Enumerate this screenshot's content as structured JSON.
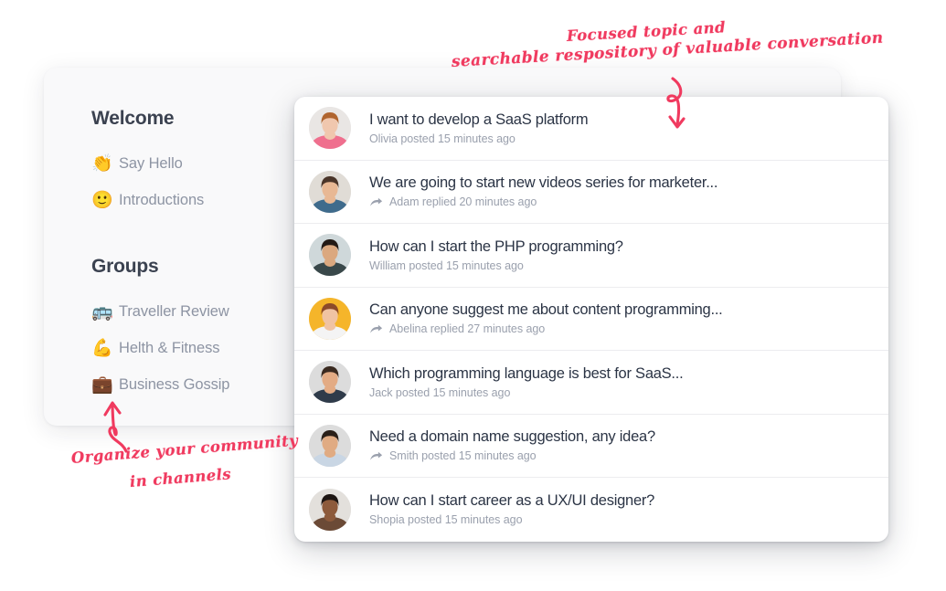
{
  "theme": {
    "accent": "#f03a5f",
    "title_color": "#2b3445",
    "meta_color": "#9aa0ad",
    "sidebar_label_color": "#8d94a3",
    "back_card_bg": "#f9f9fa",
    "front_card_bg": "#ffffff",
    "page_bg": "#ffffff",
    "divider": "#ececef"
  },
  "sidebar": {
    "welcome_title": "Welcome",
    "welcome_items": [
      {
        "emoji": "👏",
        "icon_name": "clapping-hands-emoji",
        "label": "Say Hello"
      },
      {
        "emoji": "🙂",
        "icon_name": "slightly-smiling-face-emoji",
        "label": "Introductions"
      }
    ],
    "groups_title": "Groups",
    "group_items": [
      {
        "emoji": "🚌",
        "icon_name": "bus-emoji",
        "label": "Traveller Review"
      },
      {
        "emoji": "💪",
        "icon_name": "flexed-biceps-emoji",
        "label": "Helth & Fitness"
      },
      {
        "emoji": "💼",
        "icon_name": "briefcase-emoji",
        "label": "Business Gossip"
      }
    ]
  },
  "feed": {
    "posts": [
      {
        "title": "I want to develop a SaaS platform",
        "meta": "Olivia posted 15 minutes ago",
        "author": "Olivia",
        "action": "posted",
        "time": "15 minutes ago",
        "has_reply_icon": false,
        "avatar_name": "avatar-olivia",
        "avatar_skin": "#f0c7ae",
        "avatar_hair": "#b0652f",
        "avatar_shirt": "#ef6f8e",
        "avatar_bg": "#e9e6e4"
      },
      {
        "title": "We are going to start new videos series for marketer...",
        "meta": "Adam replied 20 minutes ago",
        "author": "Adam",
        "action": "replied",
        "time": "20 minutes ago",
        "has_reply_icon": true,
        "avatar_name": "avatar-adam",
        "avatar_skin": "#e8b894",
        "avatar_hair": "#4a3529",
        "avatar_shirt": "#3f6b8c",
        "avatar_bg": "#e0dcd6"
      },
      {
        "title": "How can I start the PHP programming?",
        "meta": "William posted 15 minutes ago",
        "author": "William",
        "action": "posted",
        "time": "15 minutes ago",
        "has_reply_icon": false,
        "avatar_name": "avatar-william",
        "avatar_skin": "#dba87f",
        "avatar_hair": "#231a15",
        "avatar_shirt": "#39484a",
        "avatar_bg": "#cfd8da"
      },
      {
        "title": "Can anyone suggest me about content programming...",
        "meta": "Abelina replied 27 minutes ago",
        "author": "Abelina",
        "action": "replied",
        "time": "27 minutes ago",
        "has_reply_icon": true,
        "avatar_name": "avatar-abelina",
        "avatar_skin": "#f0c3a3",
        "avatar_hair": "#8c4a2a",
        "avatar_shirt": "#f4f4f4",
        "avatar_bg": "#f5b52a"
      },
      {
        "title": "Which programming language is best for SaaS...",
        "meta": "Jack posted 15 minutes ago",
        "author": "Jack",
        "action": "posted",
        "time": "15 minutes ago",
        "has_reply_icon": false,
        "avatar_name": "avatar-jack",
        "avatar_skin": "#e3ab84",
        "avatar_hair": "#3a2a20",
        "avatar_shirt": "#2f3b4a",
        "avatar_bg": "#dcdcdc"
      },
      {
        "title": "Need a domain name suggestion, any idea?",
        "meta": "Smith posted 15 minutes ago",
        "author": "Smith",
        "action": "posted",
        "time": "15 minutes ago",
        "has_reply_icon": true,
        "avatar_name": "avatar-smith",
        "avatar_skin": "#e0ab83",
        "avatar_hair": "#2a2019",
        "avatar_shirt": "#c9d6e4",
        "avatar_bg": "#dcdcdc"
      },
      {
        "title": "How can I start career as a UX/UI designer?",
        "meta": "Shopia posted 15 minutes ago",
        "author": "Shopia",
        "action": "posted",
        "time": "15 minutes ago",
        "has_reply_icon": false,
        "avatar_name": "avatar-shopia",
        "avatar_skin": "#8d5a3b",
        "avatar_hair": "#1d1512",
        "avatar_shirt": "#6b4a36",
        "avatar_bg": "#e3e0dc"
      }
    ]
  },
  "annotations": {
    "top_line1": "Focused topic and",
    "top_line2": "searchable respository of valuable conversation",
    "bottom_line1": "Organize your community",
    "bottom_line2": "in channels",
    "top_arrow_name": "curved-down-arrow-icon",
    "bottom_arrow_name": "curved-up-arrow-icon"
  }
}
